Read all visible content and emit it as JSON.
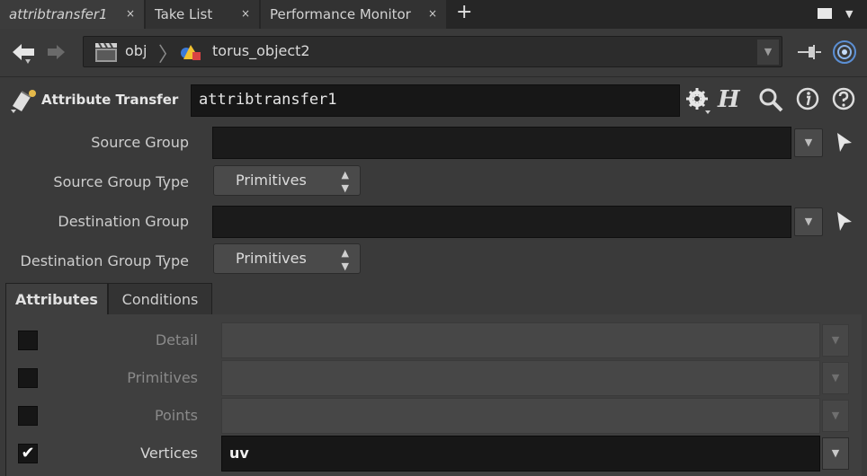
{
  "tabs": [
    {
      "label": "attribtransfer1",
      "close": "×"
    },
    {
      "label": "Take List",
      "close": "×"
    },
    {
      "label": "Performance Monitor",
      "close": "×"
    }
  ],
  "tab_add": "+",
  "path": {
    "items": [
      "obj",
      "torus_object2"
    ],
    "separator": "〉",
    "dropdown": "▼"
  },
  "node": {
    "type_label": "Attribute Transfer",
    "name": "attribtransfer1"
  },
  "params": {
    "source_group": {
      "label": "Source Group",
      "value": ""
    },
    "source_group_type": {
      "label": "Source Group Type",
      "value": "Primitives"
    },
    "destination_group": {
      "label": "Destination Group",
      "value": ""
    },
    "destination_group_type": {
      "label": "Destination Group Type",
      "value": "Primitives"
    }
  },
  "param_tabs": [
    "Attributes",
    "Conditions"
  ],
  "attributes": [
    {
      "label": "Detail",
      "checked": false,
      "value": ""
    },
    {
      "label": "Primitives",
      "checked": false,
      "value": ""
    },
    {
      "label": "Points",
      "checked": false,
      "value": ""
    },
    {
      "label": "Vertices",
      "checked": true,
      "value": "uv"
    }
  ],
  "glyphs": {
    "dd": "▼",
    "updown_up": "▲",
    "updown_down": "▼",
    "check": "✔",
    "close": "×"
  }
}
